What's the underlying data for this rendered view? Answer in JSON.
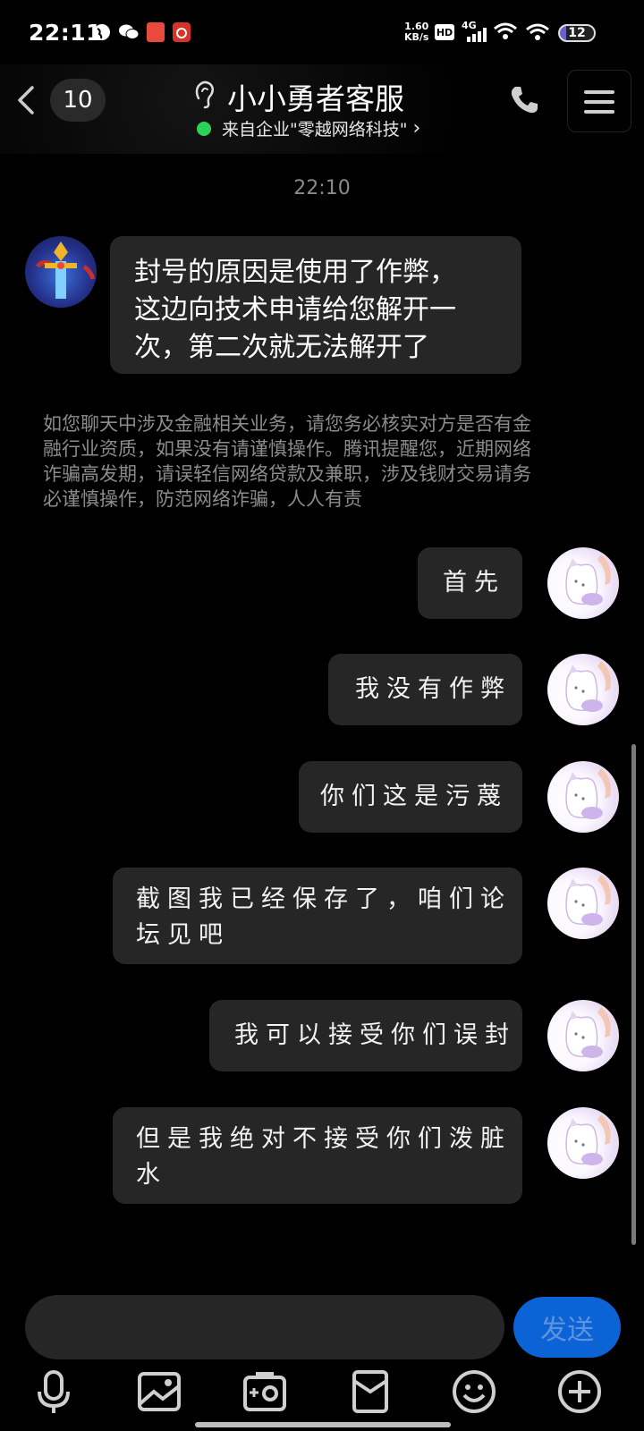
{
  "status_bar": {
    "time": "22:11",
    "net_speed_value": "1.60",
    "net_speed_unit": "KB/s",
    "hd_label": "HD",
    "network_label": "4G",
    "battery_level": "12"
  },
  "header": {
    "unread_count": "10",
    "title": "小小勇者客服",
    "subtitle": "来自企业\"零越网络科技\"",
    "subtitle_chevron": "›"
  },
  "conversation": {
    "timestamp": "22:10",
    "cs_message": {
      "lines": [
        "封号的原因是使用了作弊，",
        "这边向技术申请给您解开一",
        "次，第二次就无法解开了"
      ]
    },
    "notice_lines": [
      "如您聊天中涉及金融相关业务，请您务必核实对方是否有金",
      "融行业资质，如果没有请谨慎操作。腾讯提醒您，近期网络",
      "诈骗高发期，请误轻信网络贷款及兼职，涉及钱财交易请务",
      "必谨慎操作，防范网络诈骗，人人有责"
    ],
    "my_messages": [
      {
        "lines": [
          "首先"
        ]
      },
      {
        "lines": [
          "我没有作弊"
        ]
      },
      {
        "lines": [
          "你们这是污蔑"
        ]
      },
      {
        "lines": [
          "截图我已经保存了，咱们论",
          "坛见吧"
        ]
      },
      {
        "lines": [
          "我可以接受你们误封"
        ]
      },
      {
        "lines": [
          "但是我绝对不接受你们泼脏",
          "水"
        ]
      }
    ]
  },
  "input": {
    "send_label": "发送"
  },
  "colors": {
    "background": "#000000",
    "bubble": "#262626",
    "send_button": "#0b63d6",
    "online_dot": "#2ed158"
  },
  "icons": [
    "back-icon",
    "ear-icon",
    "phone-icon",
    "menu-icon",
    "mic-icon",
    "image-icon",
    "camera-icon",
    "red-packet-icon",
    "emoji-icon",
    "plus-icon"
  ]
}
